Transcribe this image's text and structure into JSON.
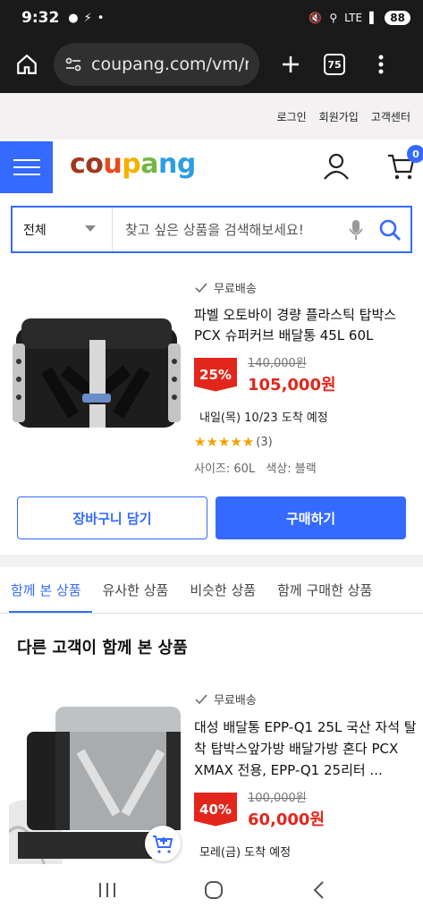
{
  "status": {
    "time": "9:32",
    "battery": "88",
    "network": "LTE"
  },
  "browser": {
    "url": "coupang.com/vm/r",
    "tab_count": "75"
  },
  "top_links": [
    "로그인",
    "회원가입",
    "고객센터"
  ],
  "header": {
    "logo": "coupang",
    "cart_count": "0",
    "logo_colors": [
      "#a1371f",
      "#e84a1c",
      "#f3b100",
      "#73b642",
      "#2c9ee1"
    ]
  },
  "search": {
    "category": "전체",
    "placeholder": "찾고 싶은 상품을 검색해보세요!"
  },
  "product": {
    "free_shipping": "무료배송",
    "title": "파벨 오토바이 경량 플라스틱 탑박스 PCX 슈퍼커브 배달통 45L 60L",
    "discount": "25%",
    "original_price": "140,000원",
    "sale_price": "105,000원",
    "delivery": "내일(목) 10/23 도착 예정",
    "rating": 5,
    "review_count": "(3)",
    "size_label": "사이즈: 60L",
    "color_label": "색상: 블랙"
  },
  "actions": {
    "add_to_cart": "장바구니 담기",
    "buy_now": "구매하기"
  },
  "rec_tabs": [
    "함께 본 상품",
    "유사한 상품",
    "비슷한 상품",
    "함께 구매한 상품"
  ],
  "section_title": "다른 고객이 함께 본 상품",
  "recommended": {
    "free_shipping": "무료배송",
    "title": "대성 배달통 EPP-Q1 25L 국산 자석 탈착 탑박스앞가방 배달가방 혼다 PCX XMAX 전용, EPP-Q1 25리터 ...",
    "discount": "40%",
    "original_price": "100,000원",
    "sale_price": "60,000원",
    "delivery": "모레(금) 도착 예정"
  },
  "colors": {
    "accent": "#346aff",
    "sale": "#e3261c",
    "star": "#f5a100"
  }
}
